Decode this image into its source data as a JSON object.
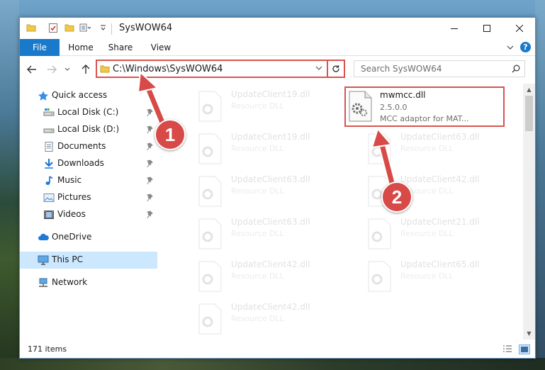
{
  "window": {
    "title": "SysWOW64"
  },
  "ribbon": {
    "tabs": [
      "File",
      "Home",
      "Share",
      "View"
    ],
    "help_label": "?"
  },
  "address": {
    "path": "C:\\Windows\\SysWOW64"
  },
  "search": {
    "placeholder": "Search SysWOW64"
  },
  "nav": {
    "items": [
      {
        "label": "Quick access",
        "icon": "star-icon"
      },
      {
        "label": "Local Disk (C:)",
        "icon": "drive-icon",
        "pinned": true
      },
      {
        "label": "Local Disk (D:)",
        "icon": "drive-icon",
        "pinned": true
      },
      {
        "label": "Documents",
        "icon": "documents-icon",
        "pinned": true
      },
      {
        "label": "Downloads",
        "icon": "download-icon",
        "pinned": true
      },
      {
        "label": "Music",
        "icon": "music-icon",
        "pinned": true
      },
      {
        "label": "Pictures",
        "icon": "pictures-icon",
        "pinned": true
      },
      {
        "label": "Videos",
        "icon": "videos-icon",
        "pinned": true
      },
      {
        "label": "OneDrive",
        "icon": "cloud-icon"
      },
      {
        "label": "This PC",
        "icon": "computer-icon",
        "selected": true
      },
      {
        "label": "Network",
        "icon": "network-icon"
      }
    ]
  },
  "files": {
    "highlighted": {
      "name": "mwmcc.dll",
      "version": "2.5.0.0",
      "description": "MCC adaptor for MAT..."
    },
    "faded": [
      {
        "name": "UpdateClient19.dll",
        "type": "Resource DLL"
      },
      {
        "name": "UpdateClient19.dll",
        "type": "Resource DLL"
      },
      {
        "name": "UpdateClient63.dll",
        "type": "Resource DLL"
      },
      {
        "name": "UpdateClient63.dll",
        "type": "Resource DLL"
      },
      {
        "name": "UpdateClient42.dll",
        "type": "Resource DLL"
      },
      {
        "name": "UpdateClient63.dll",
        "type": "Resource DLL"
      },
      {
        "name": "UpdateClient42.dll",
        "type": "Resource DLL"
      },
      {
        "name": "UpdateClient21.dll",
        "type": "Resource DLL"
      },
      {
        "name": "UpdateClient42.dll",
        "type": "Resource DLL"
      },
      {
        "name": "UpdateClient65.dll",
        "type": "Resource DLL"
      }
    ]
  },
  "status": {
    "item_count": "171 items"
  },
  "annotations": {
    "step1": "1",
    "step2": "2"
  },
  "colors": {
    "accent": "#1979ca",
    "highlight_border": "#d9534f",
    "badge": "#d74a48",
    "selection": "#cce8ff"
  }
}
